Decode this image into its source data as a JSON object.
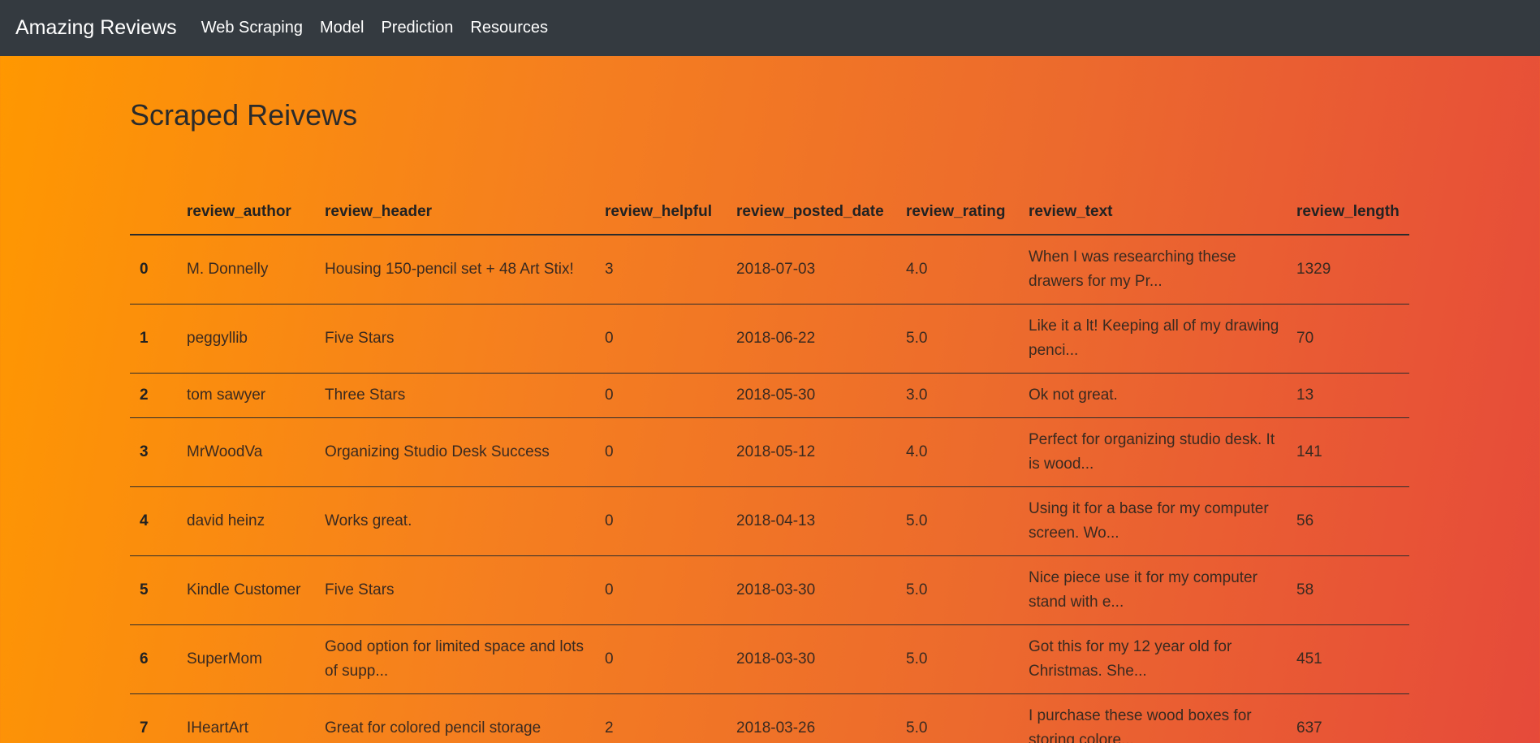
{
  "nav": {
    "brand": "Amazing Reviews",
    "links": [
      "Web Scraping",
      "Model",
      "Prediction",
      "Resources"
    ]
  },
  "page": {
    "title": "Scraped Reivews"
  },
  "table": {
    "columns": [
      "",
      "review_author",
      "review_header",
      "review_helpful",
      "review_posted_date",
      "review_rating",
      "review_text",
      "review_length"
    ],
    "rows": [
      [
        "0",
        "M. Donnelly",
        "Housing 150-pencil set + 48 Art Stix!",
        "3",
        "2018-07-03",
        "4.0",
        "When I was researching these drawers for my Pr...",
        "1329"
      ],
      [
        "1",
        "peggyllib",
        "Five Stars",
        "0",
        "2018-06-22",
        "5.0",
        "Like it a lt! Keeping all of my drawing penci...",
        "70"
      ],
      [
        "2",
        "tom sawyer",
        "Three Stars",
        "0",
        "2018-05-30",
        "3.0",
        "Ok not great.",
        "13"
      ],
      [
        "3",
        "MrWoodVa",
        "Organizing Studio Desk Success",
        "0",
        "2018-05-12",
        "4.0",
        "Perfect for organizing studio desk. It is wood...",
        "141"
      ],
      [
        "4",
        "david heinz",
        "Works great.",
        "0",
        "2018-04-13",
        "5.0",
        "Using it for a base for my computer screen. Wo...",
        "56"
      ],
      [
        "5",
        "Kindle Customer",
        "Five Stars",
        "0",
        "2018-03-30",
        "5.0",
        "Nice piece use it for my computer stand with e...",
        "58"
      ],
      [
        "6",
        "SuperMom",
        "Good option for limited space and lots of supp...",
        "0",
        "2018-03-30",
        "5.0",
        "Got this for my 12 year old for Christmas. She...",
        "451"
      ],
      [
        "7",
        "IHeartArt",
        "Great for colored pencil storage",
        "2",
        "2018-03-26",
        "5.0",
        "I purchase these wood boxes for storing colore...",
        "637"
      ]
    ]
  }
}
